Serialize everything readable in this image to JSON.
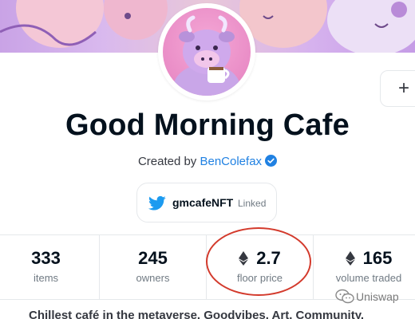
{
  "collection": {
    "title": "Good Morning Cafe",
    "created_by_prefix": "Created by",
    "creator_name": "BenColefax",
    "add_button_label": "+"
  },
  "social": {
    "handle": "gmcafeNFT",
    "status": "Linked"
  },
  "stats": [
    {
      "value": "333",
      "label": "items",
      "eth": false
    },
    {
      "value": "245",
      "label": "owners",
      "eth": false
    },
    {
      "value": "2.7",
      "label": "floor price",
      "eth": true
    },
    {
      "value": "165",
      "label": "volume traded",
      "eth": true
    }
  ],
  "description_preview": "Chillest café in the metaverse. Goodvibes. Art. Community.",
  "watermark": "Uniswap"
}
